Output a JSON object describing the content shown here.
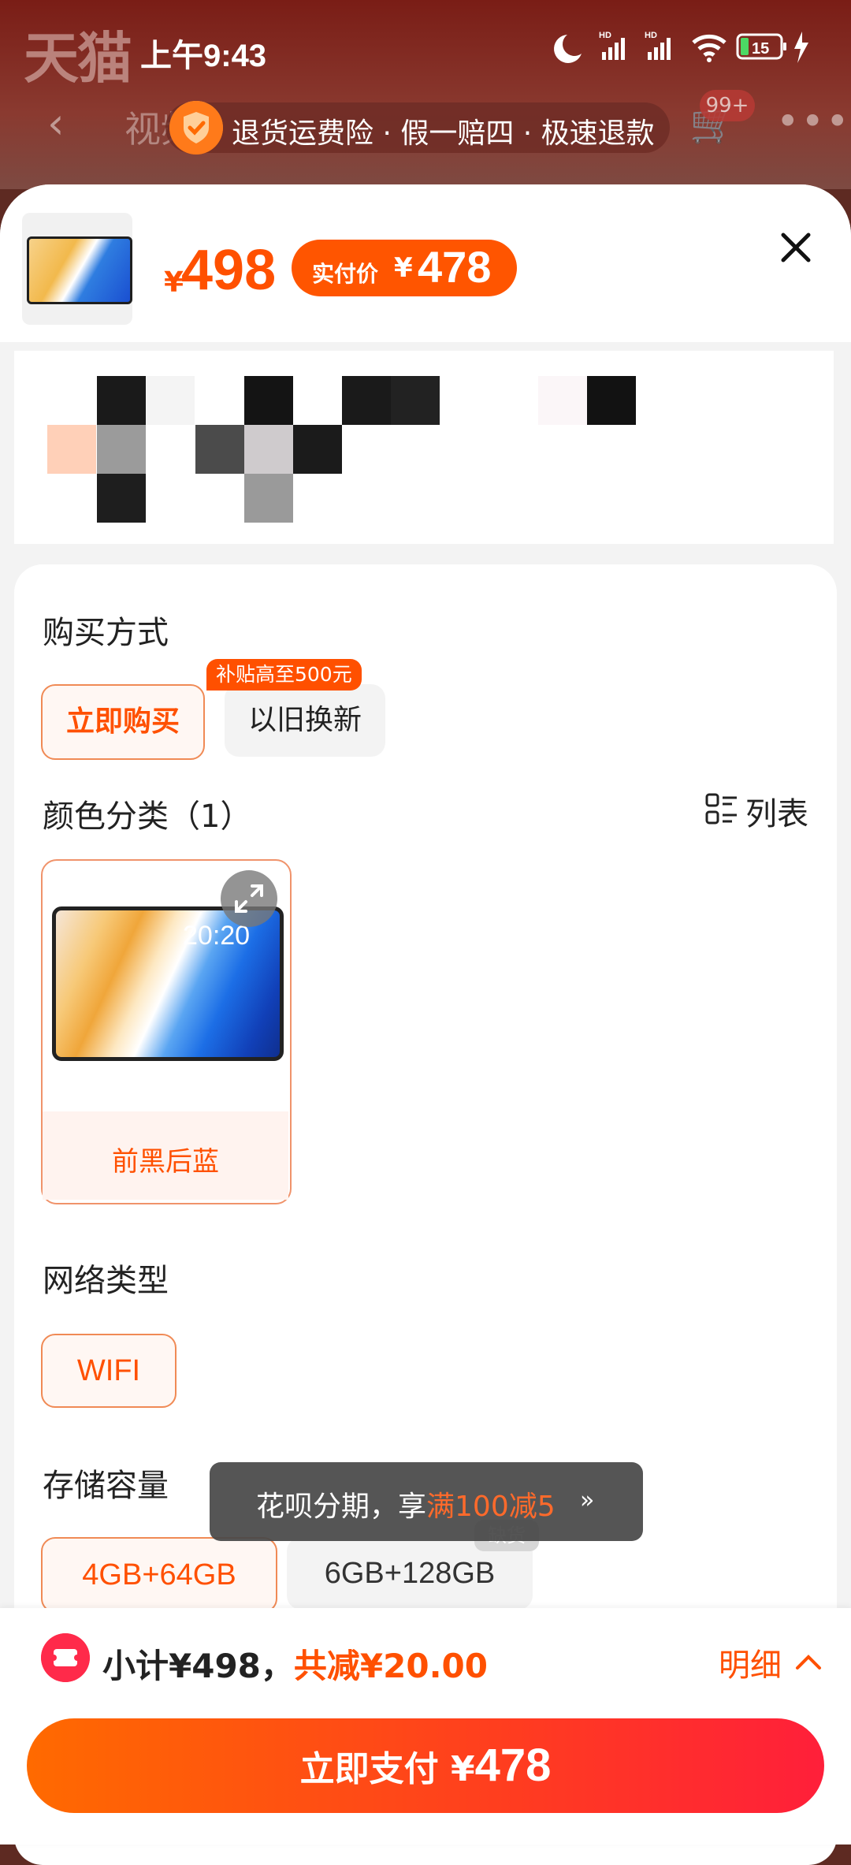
{
  "background_page": {
    "logo_text": "天猫",
    "back_icon": "chevron-left-icon",
    "tab_label": "视频",
    "cart_icon": "cart-icon",
    "cart_badge": "99+",
    "more_icon": "more-dots-icon"
  },
  "status_bar": {
    "time": "上午9:43",
    "battery": "15",
    "icons": [
      "moon-icon",
      "signal-hd-icon",
      "signal-hd-icon",
      "wifi-icon",
      "battery-icon",
      "charging-icon"
    ]
  },
  "guarantee": {
    "icon": "shield-check-icon",
    "text": "退货运费险 · 假一赔四 · 极速退款"
  },
  "header": {
    "price_symbol": "¥",
    "price": "498",
    "paid_label": "实付价",
    "paid_symbol": "¥",
    "paid_price": "478",
    "close_icon": "close-icon"
  },
  "purchase_method": {
    "title": "购买方式",
    "options": [
      "立即购买",
      "以旧换新"
    ],
    "selected": "立即购买",
    "subsidy_tag": "补贴高至500元"
  },
  "color": {
    "title": "颜色分类（1）",
    "list_toggle_label": "列表",
    "list_icon": "list-view-icon",
    "expand_icon": "expand-icon",
    "device_clock": "20:20",
    "options": [
      "前黑后蓝"
    ],
    "selected": "前黑后蓝"
  },
  "network": {
    "title": "网络类型",
    "options": [
      "WIFI"
    ],
    "selected": "WIFI"
  },
  "storage": {
    "title": "存储容量",
    "options": [
      "4GB+64GB",
      "6GB+128GB"
    ],
    "selected": "4GB+64GB",
    "out_of_stock_tag": "缺货"
  },
  "toast": {
    "prefix": "花呗分期，享",
    "highlight": "满100减5",
    "chevron_icon": "chevron-down-double-icon"
  },
  "summary": {
    "subtotal_text": "小计¥498，",
    "saved_text": "共减¥20.00",
    "detail_label": "明细",
    "coupon_icon": "coupon-icon"
  },
  "pay_button": {
    "label": "立即支付 ",
    "symbol": "¥",
    "amount": "478"
  },
  "colors": {
    "accent": "#ff5000",
    "pay_gradient_start": "#ff6a00",
    "pay_gradient_end": "#ff1f3a"
  }
}
